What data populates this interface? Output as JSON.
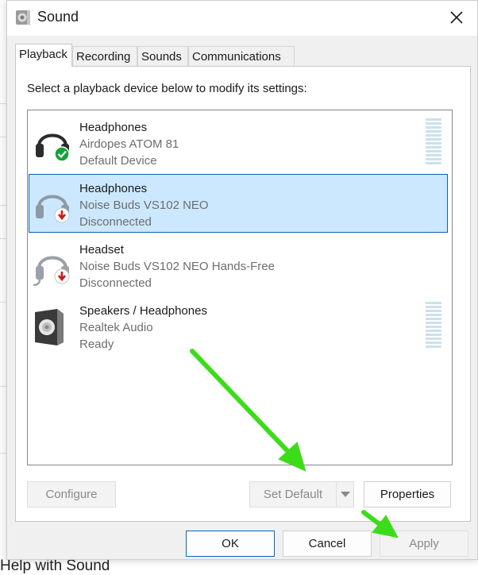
{
  "window": {
    "title": "Sound"
  },
  "tabs": [
    {
      "label": "Playback",
      "active": true
    },
    {
      "label": "Recording",
      "active": false
    },
    {
      "label": "Sounds",
      "active": false
    },
    {
      "label": "Communications",
      "active": false
    }
  ],
  "playback": {
    "instruction": "Select a playback device below to modify its settings:",
    "devices": [
      {
        "name": "Headphones",
        "description": "Airdopes ATOM 81",
        "status": "Default Device",
        "icon": "headphones-icon",
        "badge": "default-check-badge",
        "selected": false,
        "level_meter": true
      },
      {
        "name": "Headphones",
        "description": "Noise Buds VS102 NEO",
        "status": "Disconnected",
        "icon": "headphones-icon",
        "badge": "disconnected-arrow-badge",
        "selected": true,
        "level_meter": false
      },
      {
        "name": "Headset",
        "description": "Noise Buds VS102 NEO Hands-Free",
        "status": "Disconnected",
        "icon": "headset-icon",
        "badge": "disconnected-arrow-badge",
        "selected": false,
        "level_meter": false
      },
      {
        "name": "Speakers / Headphones",
        "description": "Realtek Audio",
        "status": "Ready",
        "icon": "speaker-icon",
        "badge": "",
        "selected": false,
        "level_meter": true
      }
    ],
    "buttons": {
      "configure": "Configure",
      "set_default": "Set Default",
      "properties": "Properties"
    }
  },
  "footer": {
    "ok": "OK",
    "cancel": "Cancel",
    "apply": "Apply"
  },
  "background": {
    "partial_text": "Help with Sound"
  },
  "colors": {
    "selection_bg": "#cce8ff",
    "selection_border": "#0e5ea7",
    "annotation_arrow": "#3ddc1a",
    "default_badge": "#14a33a",
    "disconnected_badge": "#d01818"
  }
}
